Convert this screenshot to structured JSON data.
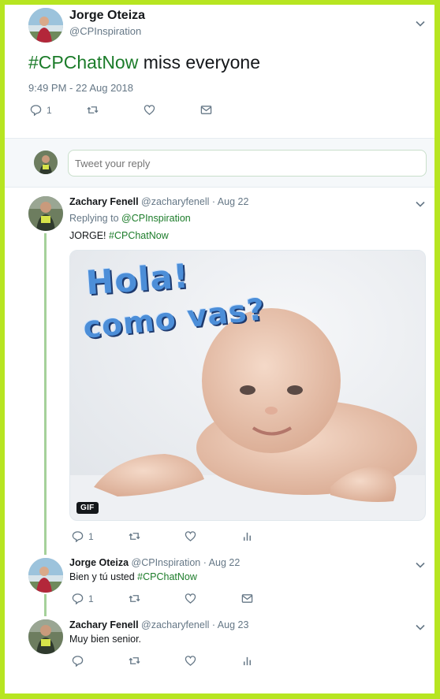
{
  "colors": {
    "border_accent": "#b7e521",
    "hashtag": "#1c7c2a",
    "thread_line": "#a5d19a",
    "muted": "#657786"
  },
  "main_tweet": {
    "name": "Jorge Oteiza",
    "handle": "@CPInspiration",
    "hashtag": "#CPChatNow",
    "text": " miss everyone",
    "timestamp": "9:49 PM - 22 Aug 2018",
    "reply_count": "1",
    "icons": [
      "reply-icon",
      "retweet-icon",
      "like-icon",
      "dm-icon"
    ]
  },
  "reply_box": {
    "placeholder": "Tweet your reply"
  },
  "thread": [
    {
      "name": "Zachary Fenell",
      "handle": "@zacharyfenell",
      "date": "· Aug 22",
      "replying_prefix": "Replying to ",
      "replying_to": "@CPInspiration",
      "text_prefix": "JORGE! ",
      "hashtag": "#CPChatNow",
      "media": {
        "badge": "GIF",
        "caption_line1": "Hola!",
        "caption_line2": "como vas?"
      },
      "reply_count": "1"
    },
    {
      "name": "Jorge Oteiza",
      "handle": "@CPInspiration",
      "date": "· Aug 22",
      "text_prefix": "Bien y tú usted ",
      "hashtag": "#CPChatNow",
      "reply_count": "1"
    },
    {
      "name": "Zachary Fenell",
      "handle": "@zacharyfenell",
      "date": "· Aug 23",
      "text": "Muy bien senior."
    }
  ]
}
